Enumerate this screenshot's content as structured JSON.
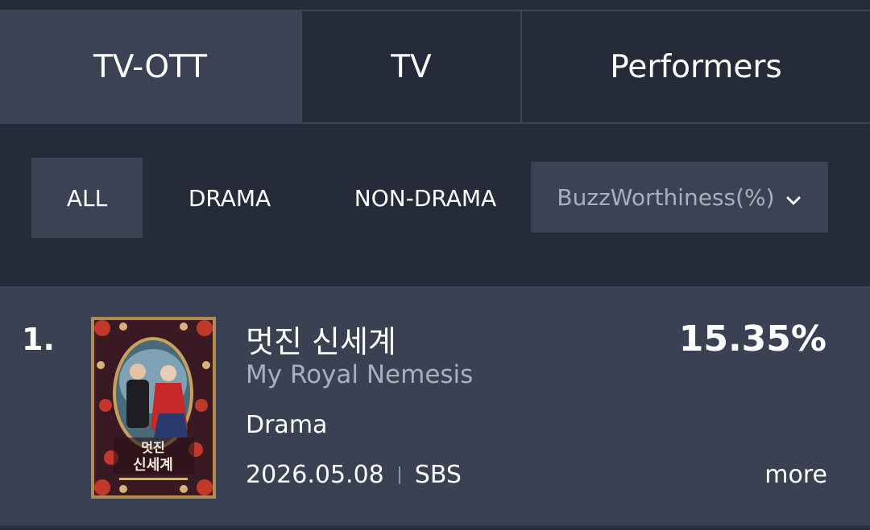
{
  "tabs": [
    {
      "label": "TV-OTT",
      "active": true
    },
    {
      "label": "TV",
      "active": false
    },
    {
      "label": "Performers",
      "active": false
    }
  ],
  "filters": {
    "all": "ALL",
    "drama": "DRAMA",
    "non_drama": "NON-DRAMA",
    "active": "ALL"
  },
  "metric_select": {
    "value": "BuzzWorthiness(%)",
    "icon": "chevron-down-icon"
  },
  "ranking": [
    {
      "rank": "1.",
      "title_ko": "멋진 신세계",
      "title_en": "My Royal Nemesis",
      "genre": "Drama",
      "date": "2026.05.08",
      "channel": "SBS",
      "percent": "15.35%",
      "more_label": "more",
      "poster_title": "멋진 신세계"
    }
  ],
  "colors": {
    "background": "#252b38",
    "panel": "#3a4152",
    "active_tab": "#3b4253",
    "muted_text": "#a9afbd"
  }
}
